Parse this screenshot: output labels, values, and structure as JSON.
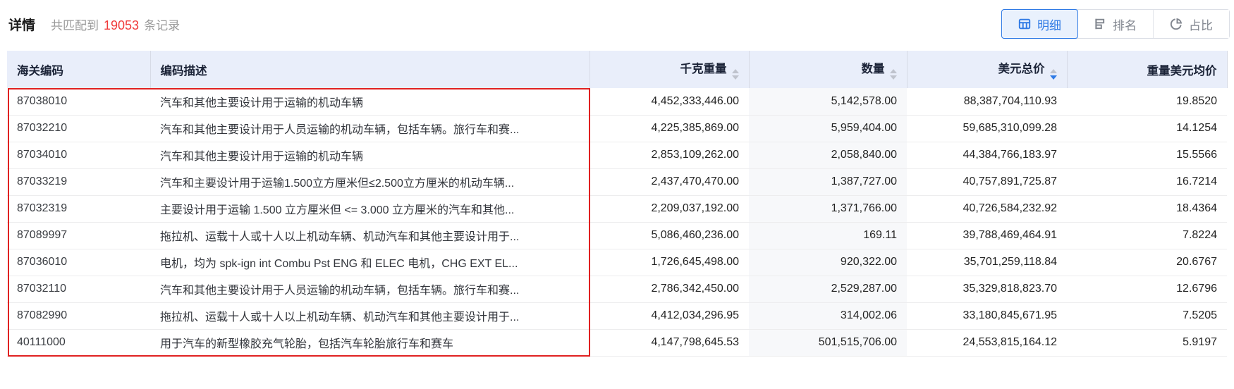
{
  "header": {
    "title": "详情",
    "match_prefix": "共匹配到",
    "match_count": "19053",
    "match_suffix": "条记录",
    "view_tabs": [
      {
        "label": "明细",
        "icon": "table-grid-icon",
        "active": true
      },
      {
        "label": "排名",
        "icon": "ranking-icon",
        "active": false
      },
      {
        "label": "占比",
        "icon": "pie-chart-icon",
        "active": false
      }
    ]
  },
  "table": {
    "columns": [
      {
        "label": "海关编码",
        "key": "code",
        "align": "left",
        "sortable": false,
        "sort": null
      },
      {
        "label": "编码描述",
        "key": "desc",
        "align": "left",
        "sortable": false,
        "sort": null
      },
      {
        "label": "千克重量",
        "key": "kg",
        "align": "right",
        "sortable": true,
        "sort": null
      },
      {
        "label": "数量",
        "key": "qty",
        "align": "right",
        "sortable": true,
        "sort": null
      },
      {
        "label": "美元总价",
        "key": "usd",
        "align": "right",
        "sortable": true,
        "sort": "desc"
      },
      {
        "label": "重量美元均价",
        "key": "avg",
        "align": "right",
        "sortable": false,
        "sort": null
      }
    ],
    "rows": [
      {
        "code": "87038010",
        "desc": "汽车和其他主要设计用于运输的机动车辆",
        "kg": "4,452,333,446.00",
        "qty": "5,142,578.00",
        "usd": "88,387,704,110.93",
        "avg": "19.8520"
      },
      {
        "code": "87032210",
        "desc": "汽车和其他主要设计用于人员运输的机动车辆，包括车辆。旅行车和赛...",
        "kg": "4,225,385,869.00",
        "qty": "5,959,404.00",
        "usd": "59,685,310,099.28",
        "avg": "14.1254"
      },
      {
        "code": "87034010",
        "desc": "汽车和其他主要设计用于运输的机动车辆",
        "kg": "2,853,109,262.00",
        "qty": "2,058,840.00",
        "usd": "44,384,766,183.97",
        "avg": "15.5566"
      },
      {
        "code": "87033219",
        "desc": "汽车和主要设计用于运输1.500立方厘米但≤2.500立方厘米的机动车辆...",
        "kg": "2,437,470,470.00",
        "qty": "1,387,727.00",
        "usd": "40,757,891,725.87",
        "avg": "16.7214"
      },
      {
        "code": "87032319",
        "desc": "主要设计用于运输 1.500 立方厘米但 <= 3.000 立方厘米的汽车和其他...",
        "kg": "2,209,037,192.00",
        "qty": "1,371,766.00",
        "usd": "40,726,584,232.92",
        "avg": "18.4364"
      },
      {
        "code": "87089997",
        "desc": "拖拉机、运载十人或十人以上机动车辆、机动汽车和其他主要设计用于...",
        "kg": "5,086,460,236.00",
        "qty": "169.11",
        "usd": "39,788,469,464.91",
        "avg": "7.8224"
      },
      {
        "code": "87036010",
        "desc": "电机，均为 spk-ign int Combu Pst ENG 和 ELEC 电机，CHG EXT EL...",
        "kg": "1,726,645,498.00",
        "qty": "920,322.00",
        "usd": "35,701,259,118.84",
        "avg": "20.6767"
      },
      {
        "code": "87032110",
        "desc": "汽车和其他主要设计用于人员运输的机动车辆，包括车辆。旅行车和赛...",
        "kg": "2,786,342,450.00",
        "qty": "2,529,287.00",
        "usd": "35,329,818,823.70",
        "avg": "12.6796"
      },
      {
        "code": "87082990",
        "desc": "拖拉机、运载十人或十人以上机动车辆、机动汽车和其他主要设计用于...",
        "kg": "4,412,034,296.95",
        "qty": "314,002.06",
        "usd": "33,180,845,671.95",
        "avg": "7.5205"
      },
      {
        "code": "40111000",
        "desc": "用于汽车的新型橡胶充气轮胎，包括汽车轮胎旅行车和赛车",
        "kg": "4,147,798,645.53",
        "qty": "501,515,706.00",
        "usd": "24,553,815,164.12",
        "avg": "5.9197"
      }
    ]
  },
  "colors": {
    "accent_blue": "#2f7ae5",
    "count_red": "#f03a3a",
    "highlight_border_red": "#e02121",
    "table_header_bg": "#e9eefa",
    "qty_column_bg": "#f7f8fa"
  }
}
